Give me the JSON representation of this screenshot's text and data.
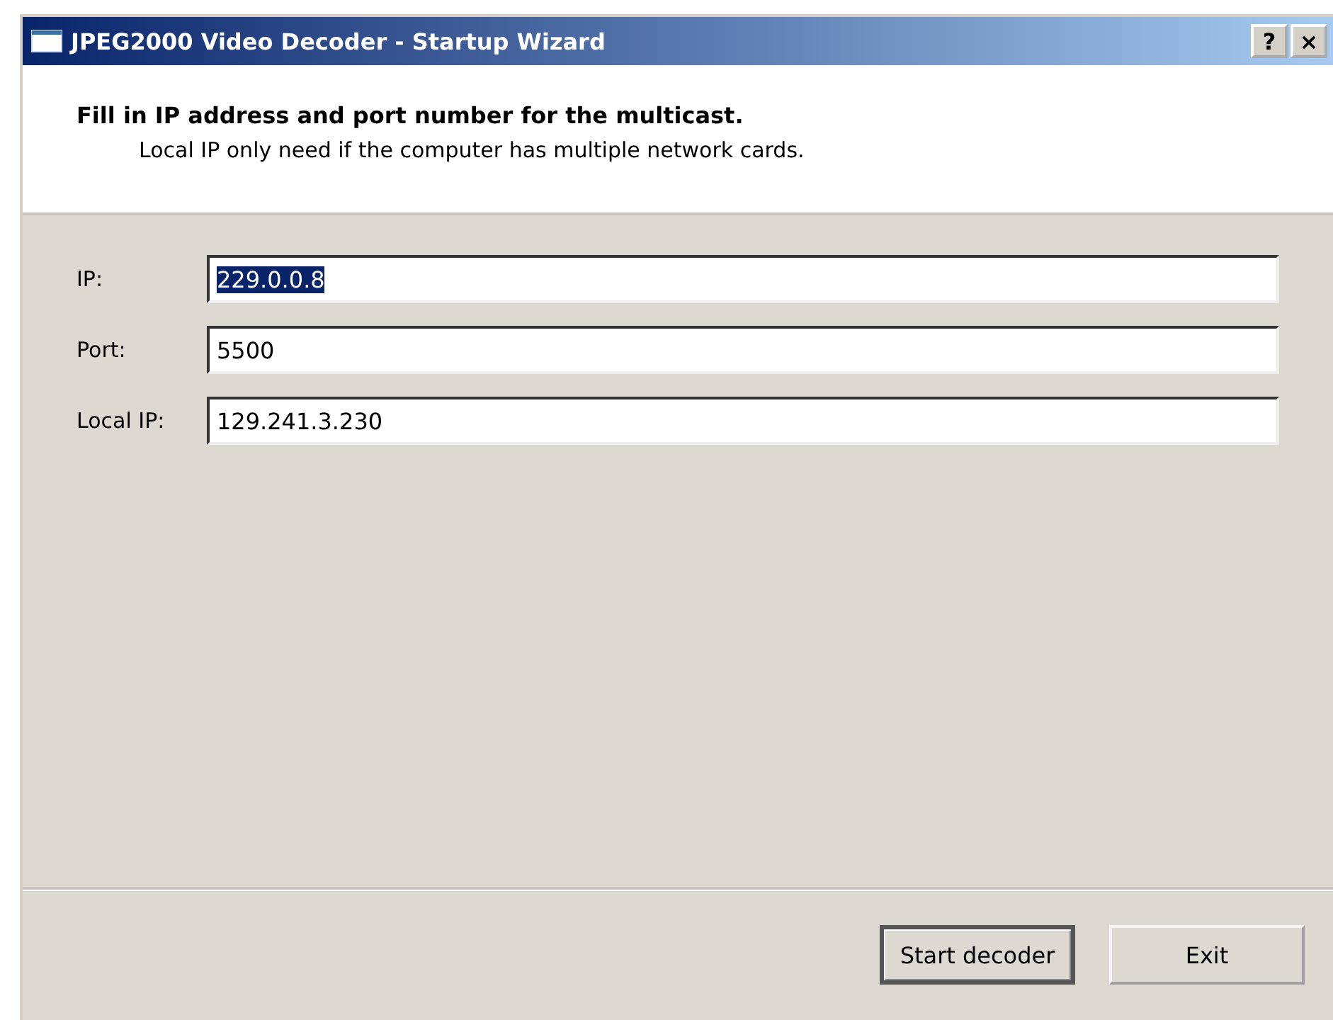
{
  "window": {
    "title": "JPEG2000 Video Decoder - Startup Wizard",
    "controls": [
      {
        "kind": "help",
        "label": "?"
      },
      {
        "kind": "close",
        "label": "×"
      }
    ]
  },
  "header": {
    "title": "Fill in IP address and port number for the multicast.",
    "subtitle": "Local IP only need if the computer has multiple network cards."
  },
  "fields": [
    {
      "label": "IP:",
      "value": "229.0.0.8",
      "text_selected": true
    },
    {
      "label": "Port:",
      "value": "5500",
      "text_selected": false
    },
    {
      "label": "Local IP:",
      "value": "129.241.3.230",
      "text_selected": false
    }
  ],
  "buttons": [
    {
      "label": "Start decoder",
      "default": true
    },
    {
      "label": "Exit",
      "default": false
    }
  ]
}
